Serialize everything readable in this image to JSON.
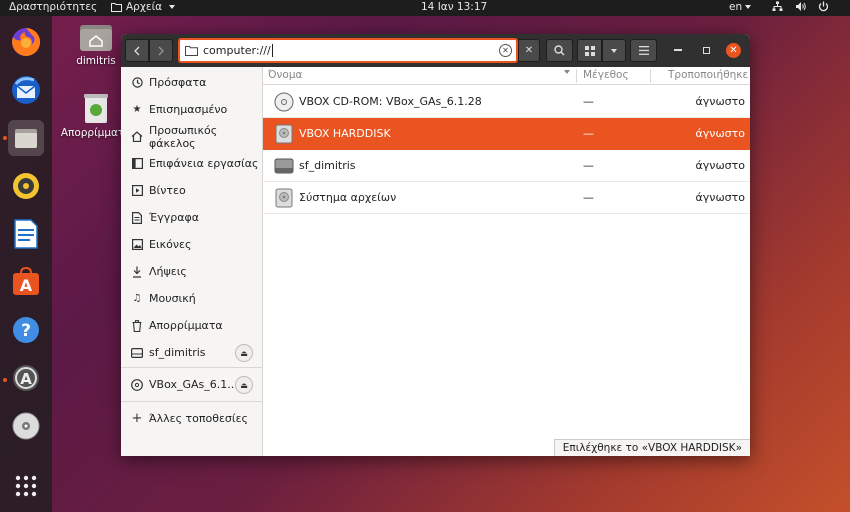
{
  "topbar": {
    "activities": "Δραστηριότητες",
    "app_menu": "Αρχεία",
    "clock": "14 Ιαν  13:17",
    "lang": "en"
  },
  "desktop": {
    "home_label": "dimitris",
    "trash_label": "Απορρίμματα"
  },
  "headerbar": {
    "location": "computer:///"
  },
  "sidebar": {
    "items": [
      {
        "label": "Πρόσφατα",
        "icon": "clock-icon"
      },
      {
        "label": "Επισημασμένο",
        "icon": "star-icon"
      },
      {
        "label": "Προσωπικός φάκελος",
        "icon": "home-icon"
      },
      {
        "label": "Επιφάνεια εργασίας",
        "icon": "desktop-icon"
      },
      {
        "label": "Βίντεο",
        "icon": "video-icon"
      },
      {
        "label": "Έγγραφα",
        "icon": "document-icon"
      },
      {
        "label": "Εικόνες",
        "icon": "image-icon"
      },
      {
        "label": "Λήψεις",
        "icon": "download-icon"
      },
      {
        "label": "Μουσική",
        "icon": "music-icon"
      },
      {
        "label": "Απορρίμματα",
        "icon": "trash-icon"
      },
      {
        "label": "sf_dimitris",
        "icon": "drive-icon"
      }
    ],
    "mounted": {
      "label": "VBox_GAs_6.1....",
      "icon": "disc-icon"
    },
    "other": {
      "label": "Άλλες τοποθεσίες",
      "icon": "plus-icon"
    }
  },
  "columns": {
    "name": "Όνομα",
    "size": "Μέγεθος",
    "modified": "Τροποποιήθηκε"
  },
  "files": [
    {
      "name": "VBOX CD-ROM: VBox_GAs_6.1.28",
      "size": "—",
      "modified": "άγνωστο",
      "icon": "disc-icon"
    },
    {
      "name": "VBOX HARDDISK",
      "size": "—",
      "modified": "άγνωστο",
      "icon": "harddisk-icon"
    },
    {
      "name": "sf_dimitris",
      "size": "—",
      "modified": "άγνωστο",
      "icon": "drive-icon"
    },
    {
      "name": "Σύστημα αρχείων",
      "size": "—",
      "modified": "άγνωστο",
      "icon": "harddisk-icon"
    }
  ],
  "status": "Επιλέχθηκε το «VBOX HARDDISK»",
  "colors": {
    "accent": "#e95420",
    "headerbar": "#303030",
    "sidebar": "#f6f5f4"
  }
}
